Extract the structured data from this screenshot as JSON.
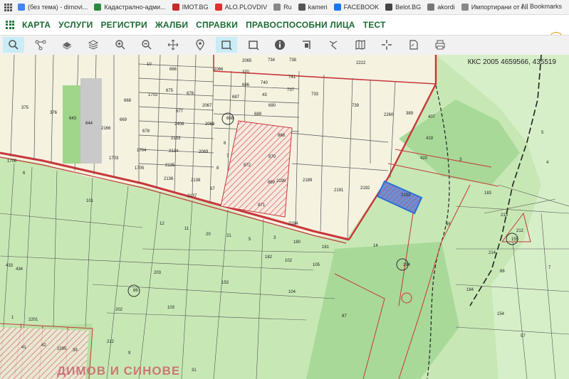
{
  "bookmarks": [
    {
      "label": "(без тема) - dimovi...",
      "color": "#4285f4"
    },
    {
      "label": "Кадастрално-адми...",
      "color": "#2b8a3e"
    },
    {
      "label": "IMOT.BG",
      "color": "#c92a2a"
    },
    {
      "label": "ALO.PLOVDIV",
      "color": "#e03131"
    },
    {
      "label": "Ru",
      "color": "#888888"
    },
    {
      "label": "kameri",
      "color": "#555555"
    },
    {
      "label": "FACEBOOK",
      "color": "#1877f2"
    },
    {
      "label": "Belot.BG",
      "color": "#444444"
    },
    {
      "label": "akordi",
      "color": "#777777"
    },
    {
      "label": "Импортирани от I...",
      "color": "#888888"
    }
  ],
  "all_bookmarks": "All Bookmarks",
  "menu": [
    "КАРТА",
    "УСЛУГИ",
    "РЕГИСТРИ",
    "ЖАЛБИ",
    "СПРАВКИ",
    "ПРАВОСПОСОБНИ ЛИЦА",
    "ТЕСТ"
  ],
  "toolbar": [
    "search-tool",
    "measure-tool",
    "layers-3d-tool",
    "layers-tool",
    "zoom-in-tool",
    "zoom-out-tool",
    "pan-tool",
    "marker-tool",
    "select-rectangle-tool",
    "frame-tool",
    "info-tool",
    "edit-tool",
    "draw-tool",
    "map-book-tool",
    "cross-tool",
    "document-tool",
    "print-tool"
  ],
  "coords": "ККС 2005 4659566, 435519",
  "map": {
    "parcel_labels": [
      "375",
      "376",
      "643",
      "644",
      "2166",
      "669",
      "668",
      "1702",
      "678",
      "1704",
      "1703",
      "1705",
      "1706",
      "6",
      "101",
      "10",
      "666",
      "675",
      "676",
      "677",
      "2408",
      "2133",
      "2134",
      "2135",
      "2136",
      "2137",
      "2138",
      "2069",
      "2068",
      "2067",
      "2066",
      "2065",
      "370",
      "686",
      "687",
      "688",
      "689",
      "690",
      "43",
      "740",
      "741",
      "738",
      "737",
      "734",
      "733",
      "739",
      "2260",
      "389",
      "407",
      "419",
      "420",
      "3",
      "4",
      "5",
      "183",
      "213",
      "212",
      "155",
      "214",
      "95",
      "14",
      "194",
      "184",
      "7",
      "68",
      "154",
      "97",
      "153",
      "203",
      "202",
      "212",
      "9",
      "31",
      "12",
      "11",
      "20",
      "21",
      "5",
      "3",
      "180",
      "181",
      "182",
      "102",
      "105",
      "86",
      "103",
      "104",
      "87",
      "67",
      "8",
      "7",
      "6",
      "872",
      "870",
      "868",
      "869",
      "871",
      "2190",
      "2189",
      "2191",
      "2192",
      "2193",
      "2194",
      "2222",
      "433",
      "434",
      "1",
      "2201",
      "2295",
      "41",
      "42",
      "39",
      "38",
      "145",
      "122",
      "146",
      "164",
      "163",
      "158"
    ],
    "stamp": "ДИМОВ И СИНОВЕ"
  }
}
